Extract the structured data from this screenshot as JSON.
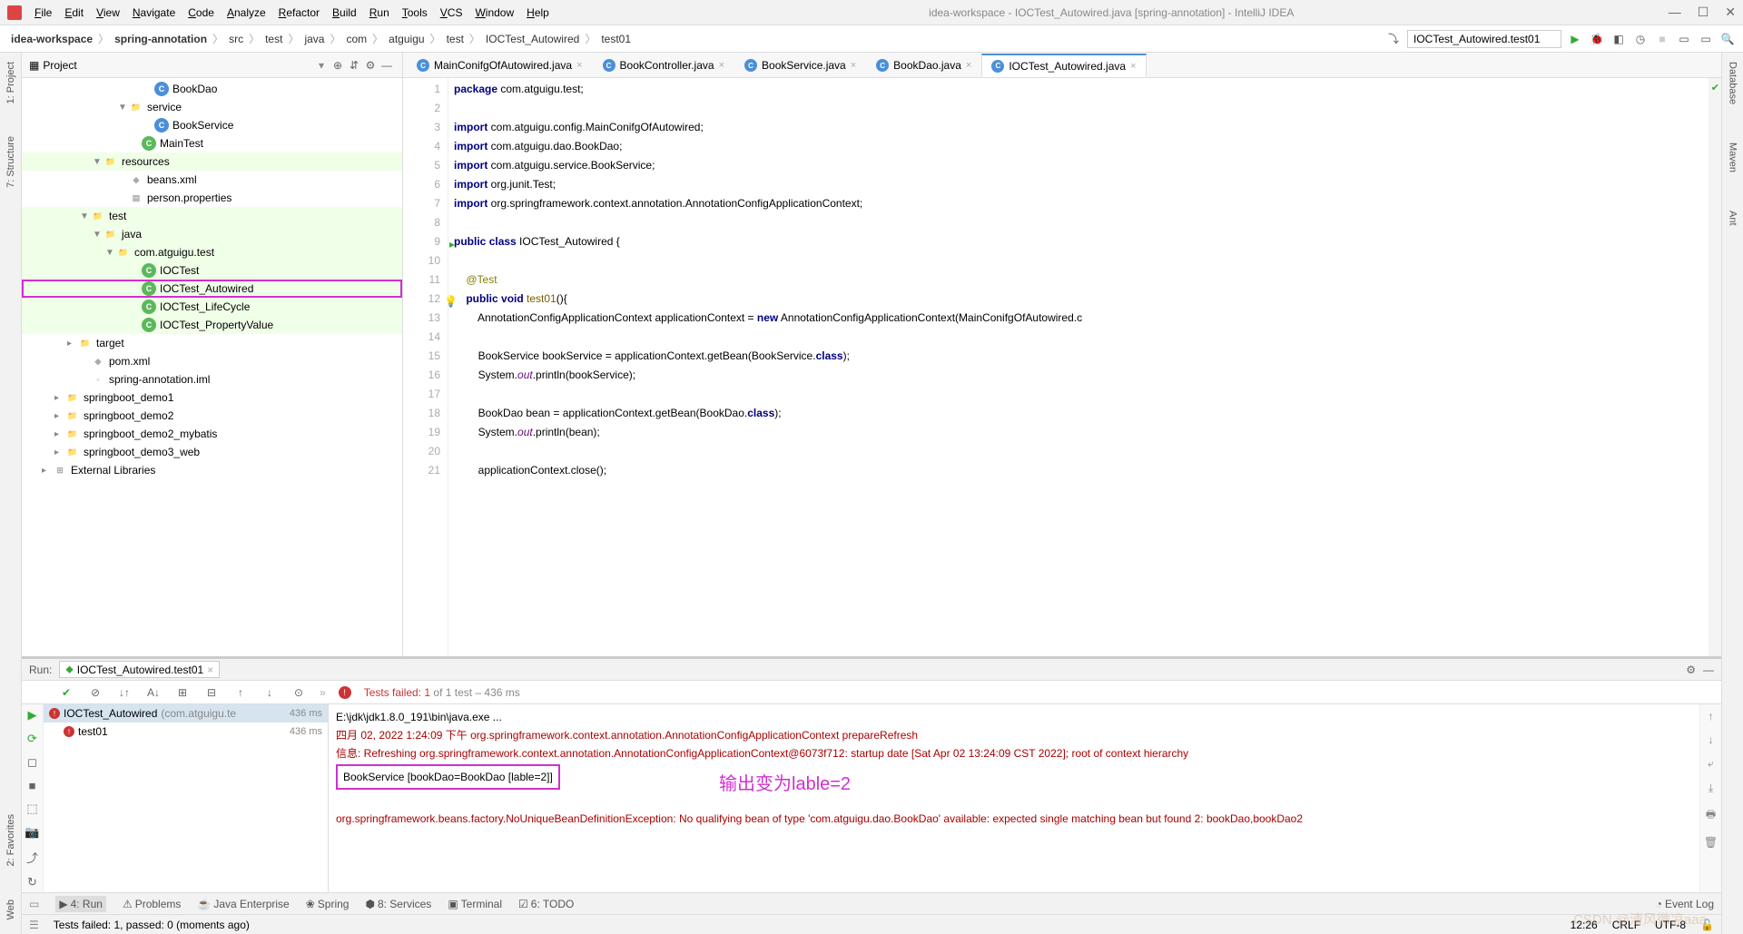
{
  "window": {
    "title": "idea-workspace - IOCTest_Autowired.java [spring-annotation] - IntelliJ IDEA"
  },
  "menu": [
    "File",
    "Edit",
    "View",
    "Navigate",
    "Code",
    "Analyze",
    "Refactor",
    "Build",
    "Run",
    "Tools",
    "VCS",
    "Window",
    "Help"
  ],
  "breadcrumb": [
    "idea-workspace",
    "spring-annotation",
    "src",
    "test",
    "java",
    "com",
    "atguigu",
    "test",
    "IOCTest_Autowired",
    "test01"
  ],
  "run_config": "IOCTest_Autowired.test01",
  "left_tool_labels": [
    "1: Project",
    "7: Structure",
    "2: Favorites",
    "Web"
  ],
  "right_tool_labels": [
    "Database",
    "Maven",
    "Ant"
  ],
  "project": {
    "title": "Project",
    "items": [
      {
        "indent": 9,
        "icon": "class",
        "label": "BookDao"
      },
      {
        "indent": 7,
        "arrow": "▼",
        "icon": "folder",
        "label": "service"
      },
      {
        "indent": 9,
        "icon": "class",
        "label": "BookService"
      },
      {
        "indent": 8,
        "icon": "class-g",
        "label": "MainTest"
      },
      {
        "indent": 5,
        "arrow": "▼",
        "icon": "folder",
        "label": "resources",
        "hl": true
      },
      {
        "indent": 7,
        "icon": "xml",
        "label": "beans.xml"
      },
      {
        "indent": 7,
        "icon": "prop",
        "label": "person.properties"
      },
      {
        "indent": 4,
        "arrow": "▼",
        "icon": "folder",
        "label": "test",
        "hl": true
      },
      {
        "indent": 5,
        "arrow": "▼",
        "icon": "folder",
        "label": "java",
        "hl": true
      },
      {
        "indent": 6,
        "arrow": "▼",
        "icon": "folder",
        "label": "com.atguigu.test",
        "hl": true
      },
      {
        "indent": 8,
        "icon": "class-g",
        "label": "IOCTest",
        "hl": true
      },
      {
        "indent": 8,
        "icon": "class-g",
        "label": "IOCTest_Autowired",
        "hl": true,
        "sel": true
      },
      {
        "indent": 8,
        "icon": "class-g",
        "label": "IOCTest_LifeCycle",
        "hl": true
      },
      {
        "indent": 8,
        "icon": "class-g",
        "label": "IOCTest_PropertyValue",
        "hl": true
      },
      {
        "indent": 3,
        "arrow": "▸",
        "icon": "folder",
        "label": "target"
      },
      {
        "indent": 4,
        "icon": "xml",
        "label": "pom.xml"
      },
      {
        "indent": 4,
        "icon": "file",
        "label": "spring-annotation.iml"
      },
      {
        "indent": 2,
        "arrow": "▸",
        "icon": "folder",
        "label": "springboot_demo1"
      },
      {
        "indent": 2,
        "arrow": "▸",
        "icon": "folder",
        "label": "springboot_demo2"
      },
      {
        "indent": 2,
        "arrow": "▸",
        "icon": "folder",
        "label": "springboot_demo2_mybatis"
      },
      {
        "indent": 2,
        "arrow": "▸",
        "icon": "folder",
        "label": "springboot_demo3_web"
      },
      {
        "indent": 1,
        "arrow": "▸",
        "icon": "lib",
        "label": "External Libraries"
      }
    ]
  },
  "tabs": [
    {
      "label": "MainConifgOfAutowired.java",
      "active": false
    },
    {
      "label": "BookController.java",
      "active": false
    },
    {
      "label": "BookService.java",
      "active": false
    },
    {
      "label": "BookDao.java",
      "active": false
    },
    {
      "label": "IOCTest_Autowired.java",
      "active": true
    }
  ],
  "editor": {
    "lines": [
      "package com.atguigu.test;",
      "",
      "import com.atguigu.config.MainConifgOfAutowired;",
      "import com.atguigu.dao.BookDao;",
      "import com.atguigu.service.BookService;",
      "import org.junit.Test;",
      "import org.springframework.context.annotation.AnnotationConfigApplicationContext;",
      "",
      "public class IOCTest_Autowired {",
      "",
      "    @Test",
      "    public void test01(){",
      "        AnnotationConfigApplicationContext applicationContext = new AnnotationConfigApplicationContext(MainConifgOfAutowired.c",
      "",
      "        BookService bookService = applicationContext.getBean(BookService.class);",
      "        System.out.println(bookService);",
      "",
      "        BookDao bean = applicationContext.getBean(BookDao.class);",
      "        System.out.println(bean);",
      "",
      "        applicationContext.close();"
    ],
    "start_line": 1
  },
  "run": {
    "label": "Run:",
    "tab": "IOCTest_Autowired.test01",
    "status": "Tests failed: 1",
    "status_suffix": " of 1 test – 436 ms",
    "tree": [
      {
        "label": "IOCTest_Autowired",
        "pkg": "(com.atguigu.te",
        "time": "436 ms",
        "sel": true
      },
      {
        "label": "test01",
        "time": "436 ms",
        "indent": 1
      }
    ],
    "console": {
      "line1": "E:\\jdk\\jdk1.8.0_191\\bin\\java.exe ...",
      "line2": "四月 02, 2022 1:24:09 下午 org.springframework.context.annotation.AnnotationConfigApplicationContext prepareRefresh",
      "line3": "信息: Refreshing org.springframework.context.annotation.AnnotationConfigApplicationContext@6073f712: startup date [Sat Apr 02 13:24:09 CST 2022]; root of context hierarchy",
      "boxed": "BookService [bookDao=BookDao [lable=2]]",
      "annotation": "输出变为lable=2",
      "err1": "org.springframework.beans.factory.NoUniqueBeanDefinitionException: No qualifying bean of type 'com.atguigu.dao.BookDao' available: expected single matching bean but found 2: bookDao,bookDao2"
    }
  },
  "bottom_tools": [
    "4: Run",
    "Problems",
    "Java Enterprise",
    "Spring",
    "8: Services",
    "Terminal",
    "6: TODO"
  ],
  "event_log": "Event Log",
  "status": {
    "msg": "Tests failed: 1, passed: 0 (moments ago)",
    "pos": "12:26",
    "enc": "CRLF",
    "charset": "UTF-8"
  },
  "watermark": "CSDN @清风微凉aaa"
}
